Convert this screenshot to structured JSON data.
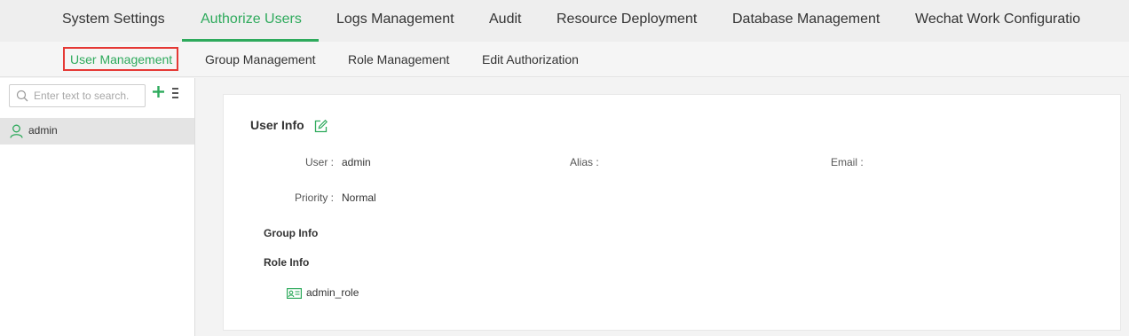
{
  "top_nav": {
    "tabs": [
      {
        "label": "System Settings"
      },
      {
        "label": "Authorize Users"
      },
      {
        "label": "Logs Management"
      },
      {
        "label": "Audit"
      },
      {
        "label": "Resource Deployment"
      },
      {
        "label": "Database Management"
      },
      {
        "label": "Wechat Work Configuratio"
      }
    ],
    "active_tab": "Authorize Users"
  },
  "sub_nav": {
    "tabs": [
      {
        "label": "User Management"
      },
      {
        "label": "Group Management"
      },
      {
        "label": "Role Management"
      },
      {
        "label": "Edit Authorization"
      }
    ],
    "active_tab": "User Management"
  },
  "sidebar": {
    "search": {
      "placeholder": "Enter text to search.",
      "value": ""
    },
    "users": [
      {
        "name": "admin"
      }
    ]
  },
  "user_info": {
    "title": "User Info",
    "user_label": "User :",
    "user_value": "admin",
    "alias_label": "Alias :",
    "alias_value": "",
    "email_label": "Email :",
    "email_value": "",
    "priority_label": "Priority :",
    "priority_value": "Normal",
    "group_info_title": "Group Info",
    "role_info_title": "Role Info",
    "roles": [
      {
        "name": "admin_role"
      }
    ]
  },
  "colors": {
    "accent": "#2eaa5c",
    "highlight_border": "#e53935"
  }
}
